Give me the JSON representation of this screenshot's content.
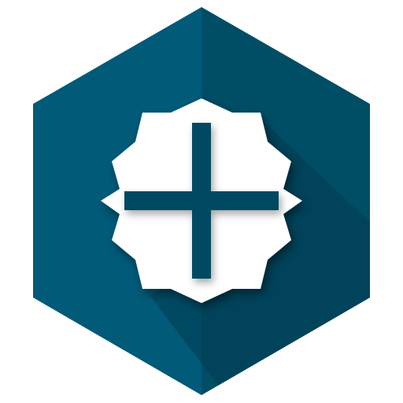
{
  "icon": {
    "name": "add-plus-badge-icon",
    "colors": {
      "hexagon_left": "#005a78",
      "hexagon_right": "#004d66",
      "long_shadow": "#003c52",
      "badge": "#ffffff",
      "plus": "#004a62"
    }
  }
}
